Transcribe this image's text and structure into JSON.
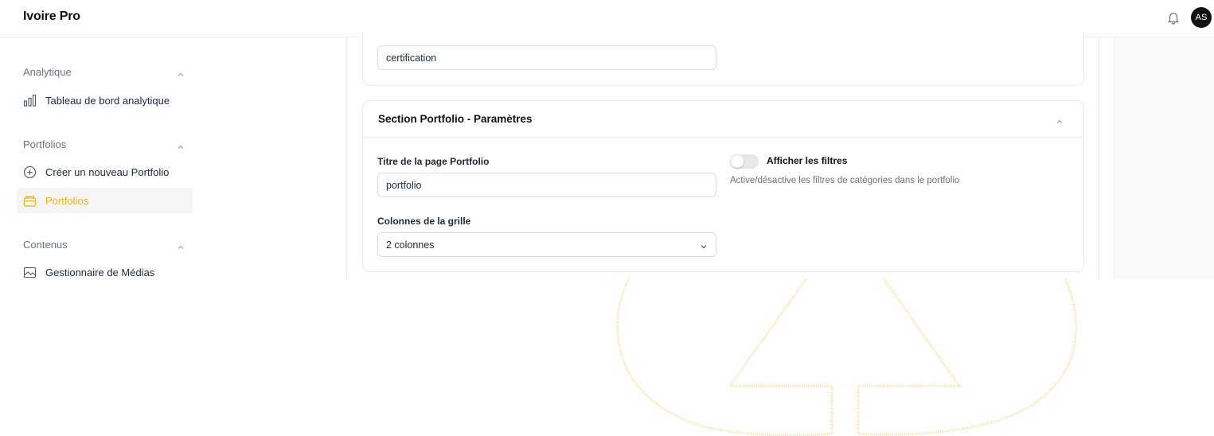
{
  "app": {
    "title": "Ivoire Pro",
    "avatar_initials": "AS"
  },
  "icons": {
    "notification": "bell-icon",
    "collapse": "chevron-up-icon",
    "select": "chevron-down-icon"
  },
  "colors": {
    "accent": "#e2b52b",
    "active_bg": "#f5f5f5",
    "muted_text": "#6b7280"
  },
  "sidebar": {
    "groups": [
      {
        "title": "Analytique",
        "items": [
          {
            "label": "Tableau de bord analytique",
            "icon": "bar-chart-icon"
          }
        ]
      },
      {
        "title": "Portfolios",
        "items": [
          {
            "label": "Créer un nouveau Portfolio",
            "icon": "plus-circle-icon"
          },
          {
            "label": "Portfolios",
            "icon": "folder-icon",
            "active": true
          }
        ]
      },
      {
        "title": "Contenus",
        "items": [
          {
            "label": "Gestionnaire de Médias",
            "icon": "image-icon"
          }
        ]
      }
    ]
  },
  "main": {
    "top_card": {
      "input_value": "certification"
    },
    "portfolio_section": {
      "title": "Section Portfolio - Paramètres",
      "page_title_label": "Titre de la page Portfolio",
      "page_title_value": "portfolio",
      "columns_label": "Colonnes de la grille",
      "columns_value": "2 colonnes",
      "filters_toggle": {
        "label": "Afficher les filtres",
        "description": "Active/désactive les filtres de catégories dans le portfolio",
        "enabled": false
      }
    }
  }
}
